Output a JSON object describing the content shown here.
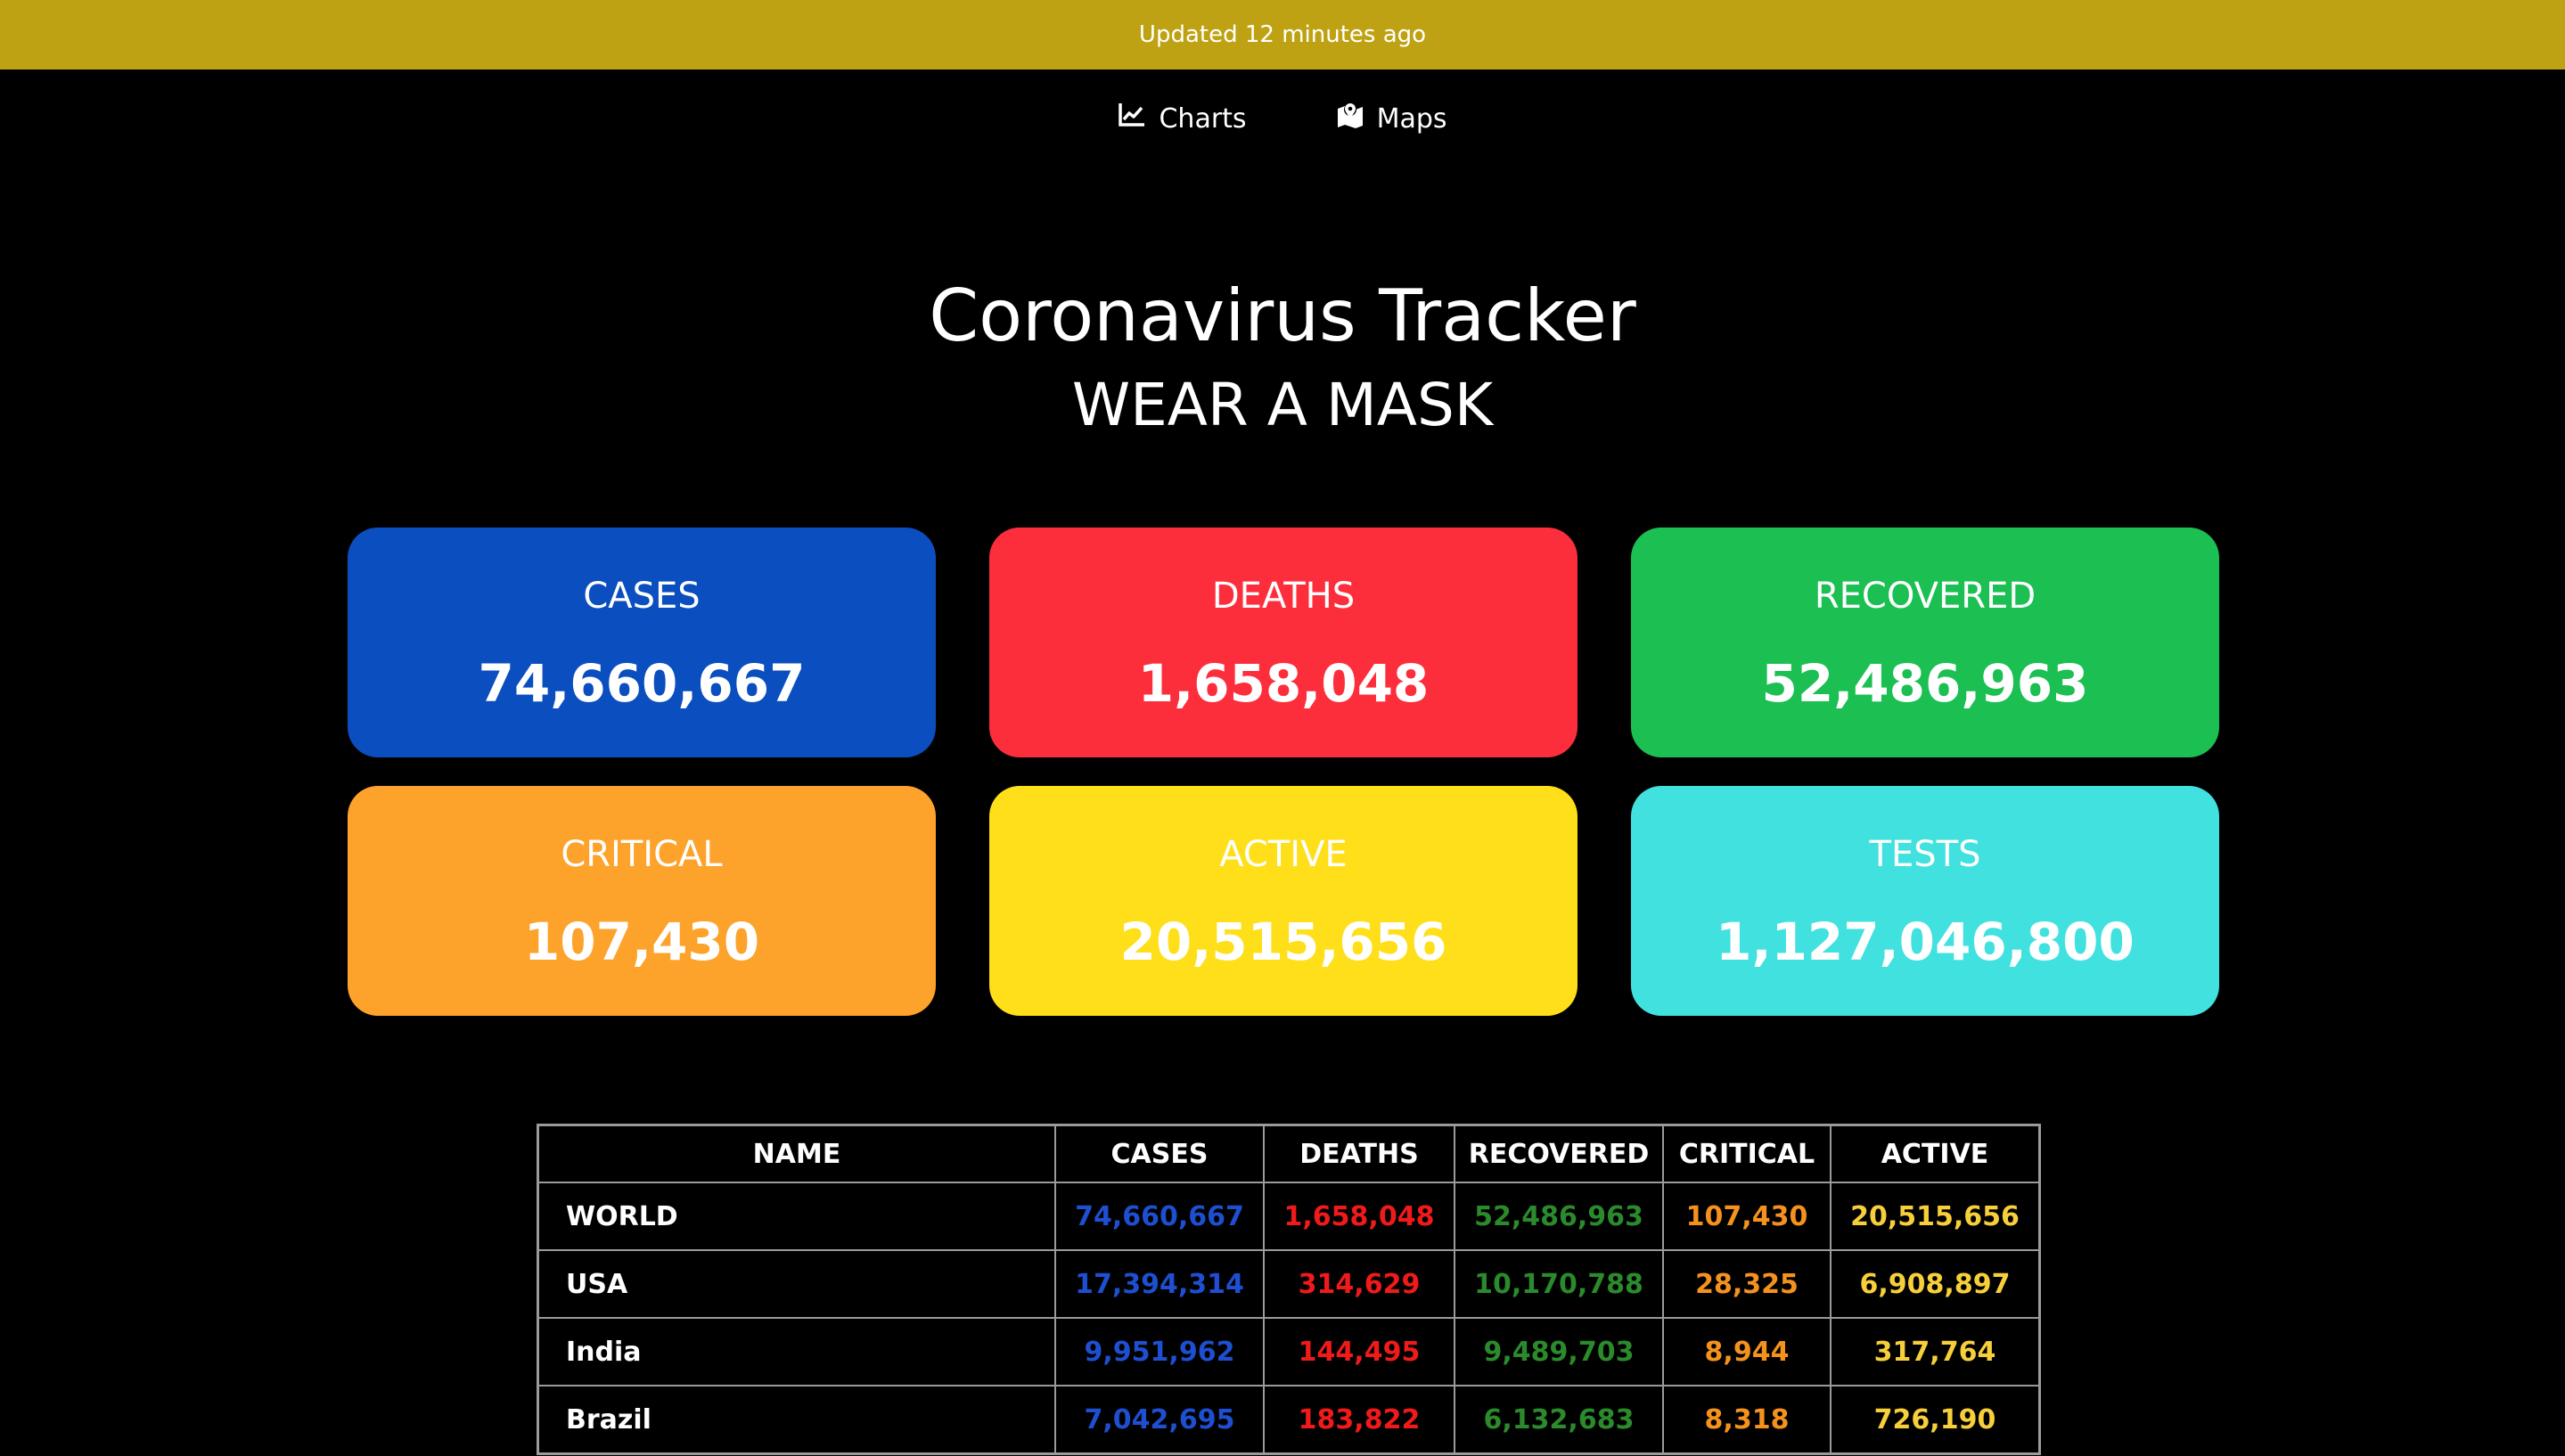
{
  "banner": {
    "text": "Updated 12 minutes ago",
    "color": "#bfa213"
  },
  "nav": {
    "items": [
      {
        "label": "Charts",
        "icon": "line-chart-icon"
      },
      {
        "label": "Maps",
        "icon": "map-marker-icon"
      }
    ]
  },
  "header": {
    "title": "Coronavirus Tracker",
    "subtitle": "WEAR A MASK"
  },
  "cards": [
    {
      "label": "CASES",
      "value": "74,660,667",
      "color": "#0b4ebf"
    },
    {
      "label": "DEATHS",
      "value": "1,658,048",
      "color": "#fd2e3c"
    },
    {
      "label": "RECOVERED",
      "value": "52,486,963",
      "color": "#1bbf52"
    },
    {
      "label": "CRITICAL",
      "value": "107,430",
      "color": "#fda22b"
    },
    {
      "label": "ACTIVE",
      "value": "20,515,656",
      "color": "#fedf19"
    },
    {
      "label": "TESTS",
      "value": "1,127,046,800",
      "color": "#41e1e0"
    }
  ],
  "table": {
    "columns": [
      "NAME",
      "CASES",
      "DEATHS",
      "RECOVERED",
      "CRITICAL",
      "ACTIVE"
    ],
    "column_colors": {
      "cases": "#1e4fd1",
      "deaths": "#f01a1a",
      "recovered": "#2b8a2b",
      "critical": "#f5921e",
      "active": "#f7cf3a"
    },
    "rows": [
      {
        "name": "WORLD",
        "cases": "74,660,667",
        "deaths": "1,658,048",
        "recovered": "52,486,963",
        "critical": "107,430",
        "active": "20,515,656"
      },
      {
        "name": "USA",
        "cases": "17,394,314",
        "deaths": "314,629",
        "recovered": "10,170,788",
        "critical": "28,325",
        "active": "6,908,897"
      },
      {
        "name": "India",
        "cases": "9,951,962",
        "deaths": "144,495",
        "recovered": "9,489,703",
        "critical": "8,944",
        "active": "317,764"
      },
      {
        "name": "Brazil",
        "cases": "7,042,695",
        "deaths": "183,822",
        "recovered": "6,132,683",
        "critical": "8,318",
        "active": "726,190"
      }
    ]
  }
}
